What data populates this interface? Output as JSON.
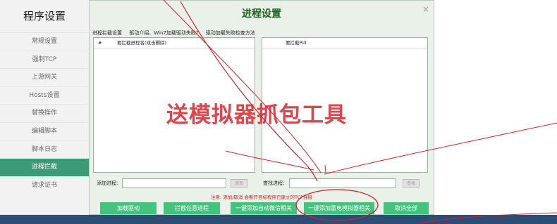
{
  "app": {
    "title": "程序设置"
  },
  "sidebar": {
    "items": [
      {
        "label": "常规设置"
      },
      {
        "label": "强制TCP"
      },
      {
        "label": "上游网关"
      },
      {
        "label": "Hosts设置"
      },
      {
        "label": "替换操作"
      },
      {
        "label": "编辑脚本"
      },
      {
        "label": "脚本日志"
      },
      {
        "label": "进程拦截"
      },
      {
        "label": "请求证书"
      }
    ],
    "active_index": 7
  },
  "dialog": {
    "title": "进程设置",
    "close_glyph": "×",
    "links": [
      "进程拦截设置",
      "驱动介绍、Win7加载驱动失败?",
      "驱动加载失败检查方法"
    ],
    "left_list": {
      "col1": "#",
      "col2": "要拦截进程名(双击删除)"
    },
    "right_list": {
      "col1": "要拦截Pid"
    },
    "add_process_label": "添加进程:",
    "add_button": "添加",
    "find_process_label": "查找进程:",
    "find_button": "查找",
    "notice": "注意: 添加/取消 会断开目标程序已建立的TCP连接",
    "buttons": [
      "加载驱动",
      "拦截任意进程",
      "一键添加自动微信相关",
      "一键添加雷电模拟器相关",
      "取消全部"
    ]
  },
  "overlay": {
    "caption": "送模拟器抓包工具"
  },
  "colors": {
    "accent": "#3c9a76",
    "button": "#46c27f",
    "caption": "#e0434a",
    "notice": "#cc1e1e",
    "annotation": "#d8202a"
  }
}
